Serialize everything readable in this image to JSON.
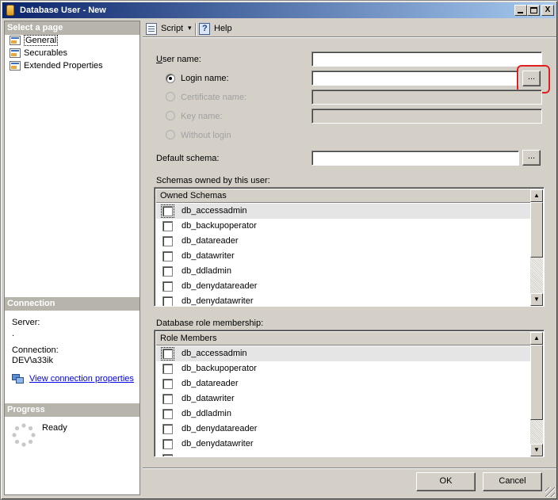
{
  "window": {
    "title": "Database User - New",
    "min_glyph": "",
    "max_glyph": "",
    "close_glyph": "X"
  },
  "left_pane": {
    "select_page_header": "Select a page",
    "pages": [
      {
        "label": "General",
        "selected": true
      },
      {
        "label": "Securables",
        "selected": false
      },
      {
        "label": "Extended Properties",
        "selected": false
      }
    ],
    "connection_header": "Connection",
    "server_label": "Server:",
    "server_value": ".",
    "connection_label": "Connection:",
    "connection_value": "DEV\\a33ik",
    "view_connection_link": "View connection properties",
    "progress_header": "Progress",
    "progress_status": "Ready"
  },
  "toolbar": {
    "script_label": "Script",
    "script_dropdown": "▾",
    "help_label": "Help"
  },
  "form": {
    "user_name_label": "User name:",
    "user_name_value": "",
    "login_name_label": "Login name:",
    "login_name_value": "",
    "login_name_selected": true,
    "certificate_name_label": "Certificate name:",
    "key_name_label": "Key name:",
    "without_login_label": "Without login",
    "default_schema_label": "Default schema:",
    "default_schema_value": "",
    "browse_label": "..."
  },
  "schemas_owned": {
    "label": "Schemas owned by this user:",
    "column_header": "Owned Schemas",
    "rows": [
      "db_accessadmin",
      "db_backupoperator",
      "db_datareader",
      "db_datawriter",
      "db_ddladmin",
      "db_denydatareader",
      "db_denydatawriter"
    ]
  },
  "role_membership": {
    "label": "Database role membership:",
    "column_header": "Role Members",
    "rows": [
      "db_accessadmin",
      "db_backupoperator",
      "db_datareader",
      "db_datawriter",
      "db_ddladmin",
      "db_denydatareader",
      "db_denydatawriter"
    ]
  },
  "scroll_glyphs": {
    "up": "▲",
    "down": "▼"
  },
  "buttons": {
    "ok": "OK",
    "cancel": "Cancel"
  },
  "colors": {
    "titlebar_start": "#0a246a",
    "titlebar_end": "#a6caf0",
    "highlight_ring": "#e02020",
    "link": "#0000ee"
  }
}
